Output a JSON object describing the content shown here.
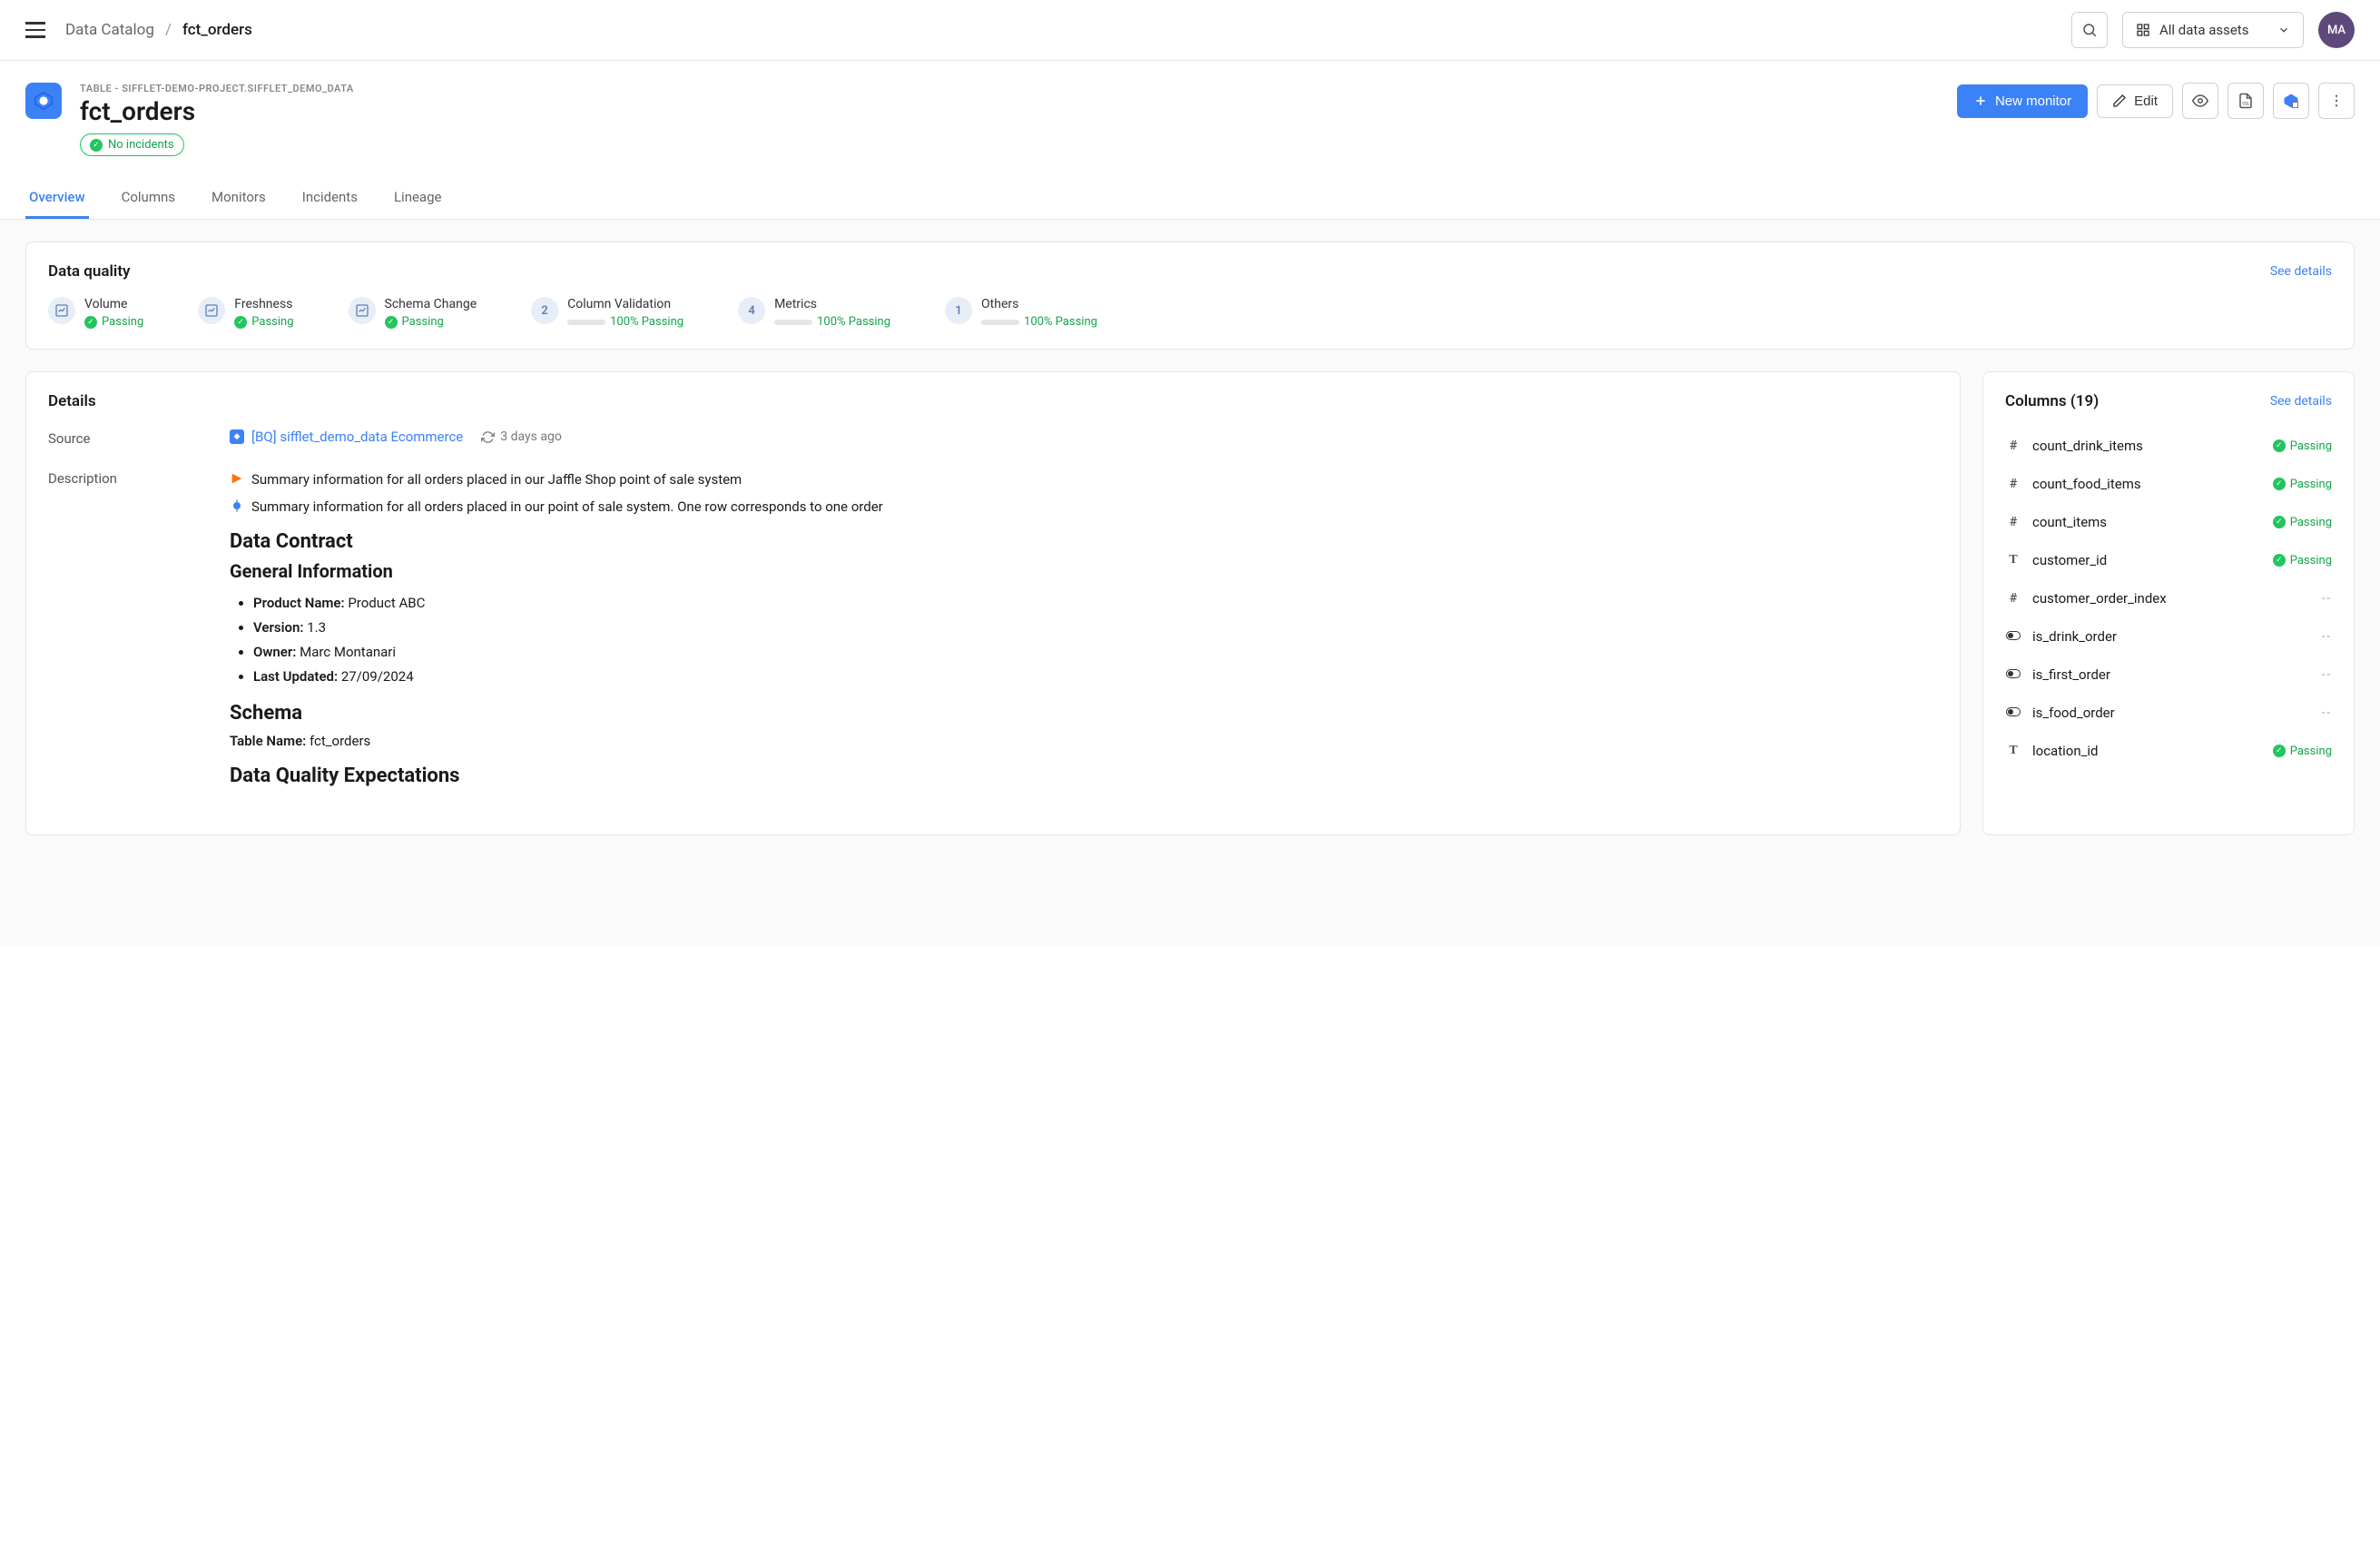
{
  "topbar": {
    "breadcrumb_root": "Data Catalog",
    "breadcrumb_current": "fct_orders",
    "assets_dropdown": "All data assets",
    "avatar": "MA"
  },
  "asset": {
    "path": "TABLE - SIFFLET-DEMO-PROJECT.SIFFLET_DEMO_DATA",
    "title": "fct_orders",
    "incident_badge": "No incidents"
  },
  "actions": {
    "new_monitor": "New monitor",
    "edit": "Edit"
  },
  "tabs": {
    "overview": "Overview",
    "columns": "Columns",
    "monitors": "Monitors",
    "incidents": "Incidents",
    "lineage": "Lineage"
  },
  "data_quality": {
    "title": "Data quality",
    "see_details": "See details",
    "items": [
      {
        "label": "Volume",
        "status": "Passing",
        "kind": "simple"
      },
      {
        "label": "Freshness",
        "status": "Passing",
        "kind": "simple"
      },
      {
        "label": "Schema Change",
        "status": "Passing",
        "kind": "simple"
      },
      {
        "label": "Column Validation",
        "status": "100% Passing",
        "kind": "count",
        "count": "2"
      },
      {
        "label": "Metrics",
        "status": "100% Passing",
        "kind": "count",
        "count": "4"
      },
      {
        "label": "Others",
        "status": "100% Passing",
        "kind": "count",
        "count": "1"
      }
    ]
  },
  "details": {
    "title": "Details",
    "source_label": "Source",
    "source_text": "[BQ] sifflet_demo_data Ecommerce",
    "source_refresh": "3 days ago",
    "description_label": "Description",
    "desc_line1": "Summary information for all orders placed in our Jaffle Shop point of sale system",
    "desc_line2": "Summary information for all orders placed in our point of sale system. One row corresponds to one order",
    "h2_contract": "Data Contract",
    "h3_general": "General Information",
    "product_name_k": "Product Name:",
    "product_name_v": "Product ABC",
    "version_k": "Version:",
    "version_v": "1.3",
    "owner_k": "Owner:",
    "owner_v": "Marc Montanari",
    "updated_k": "Last Updated:",
    "updated_v": "27/09/2024",
    "h2_schema": "Schema",
    "schema_table_k": "Table Name:",
    "schema_table_v": "fct_orders",
    "h2_dqe": "Data Quality Expectations"
  },
  "columns_panel": {
    "title": "Columns (19)",
    "see_details": "See details",
    "items": [
      {
        "type": "num",
        "name": "count_drink_items",
        "status": "Passing"
      },
      {
        "type": "num",
        "name": "count_food_items",
        "status": "Passing"
      },
      {
        "type": "num",
        "name": "count_items",
        "status": "Passing"
      },
      {
        "type": "text",
        "name": "customer_id",
        "status": "Passing"
      },
      {
        "type": "num",
        "name": "customer_order_index",
        "status": "--"
      },
      {
        "type": "bool",
        "name": "is_drink_order",
        "status": "--"
      },
      {
        "type": "bool",
        "name": "is_first_order",
        "status": "--"
      },
      {
        "type": "bool",
        "name": "is_food_order",
        "status": "--"
      },
      {
        "type": "text",
        "name": "location_id",
        "status": "Passing"
      }
    ]
  }
}
